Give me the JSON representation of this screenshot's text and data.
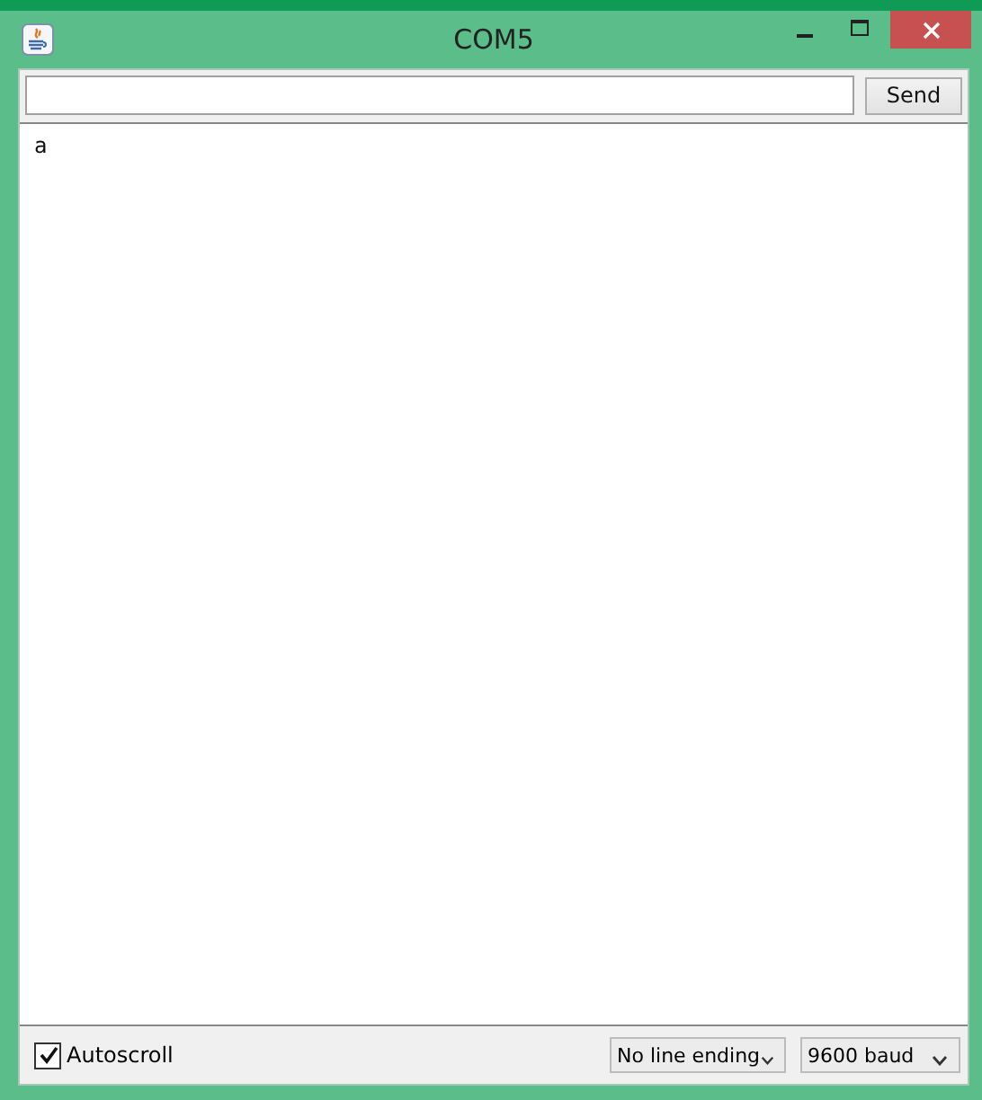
{
  "window": {
    "title": "COM5"
  },
  "send_button": "Send",
  "output": [
    "a"
  ],
  "autoscroll": {
    "label": "Autoscroll",
    "checked": true
  },
  "line_ending": {
    "value": "No line ending"
  },
  "baud": {
    "value": "9600 baud"
  }
}
